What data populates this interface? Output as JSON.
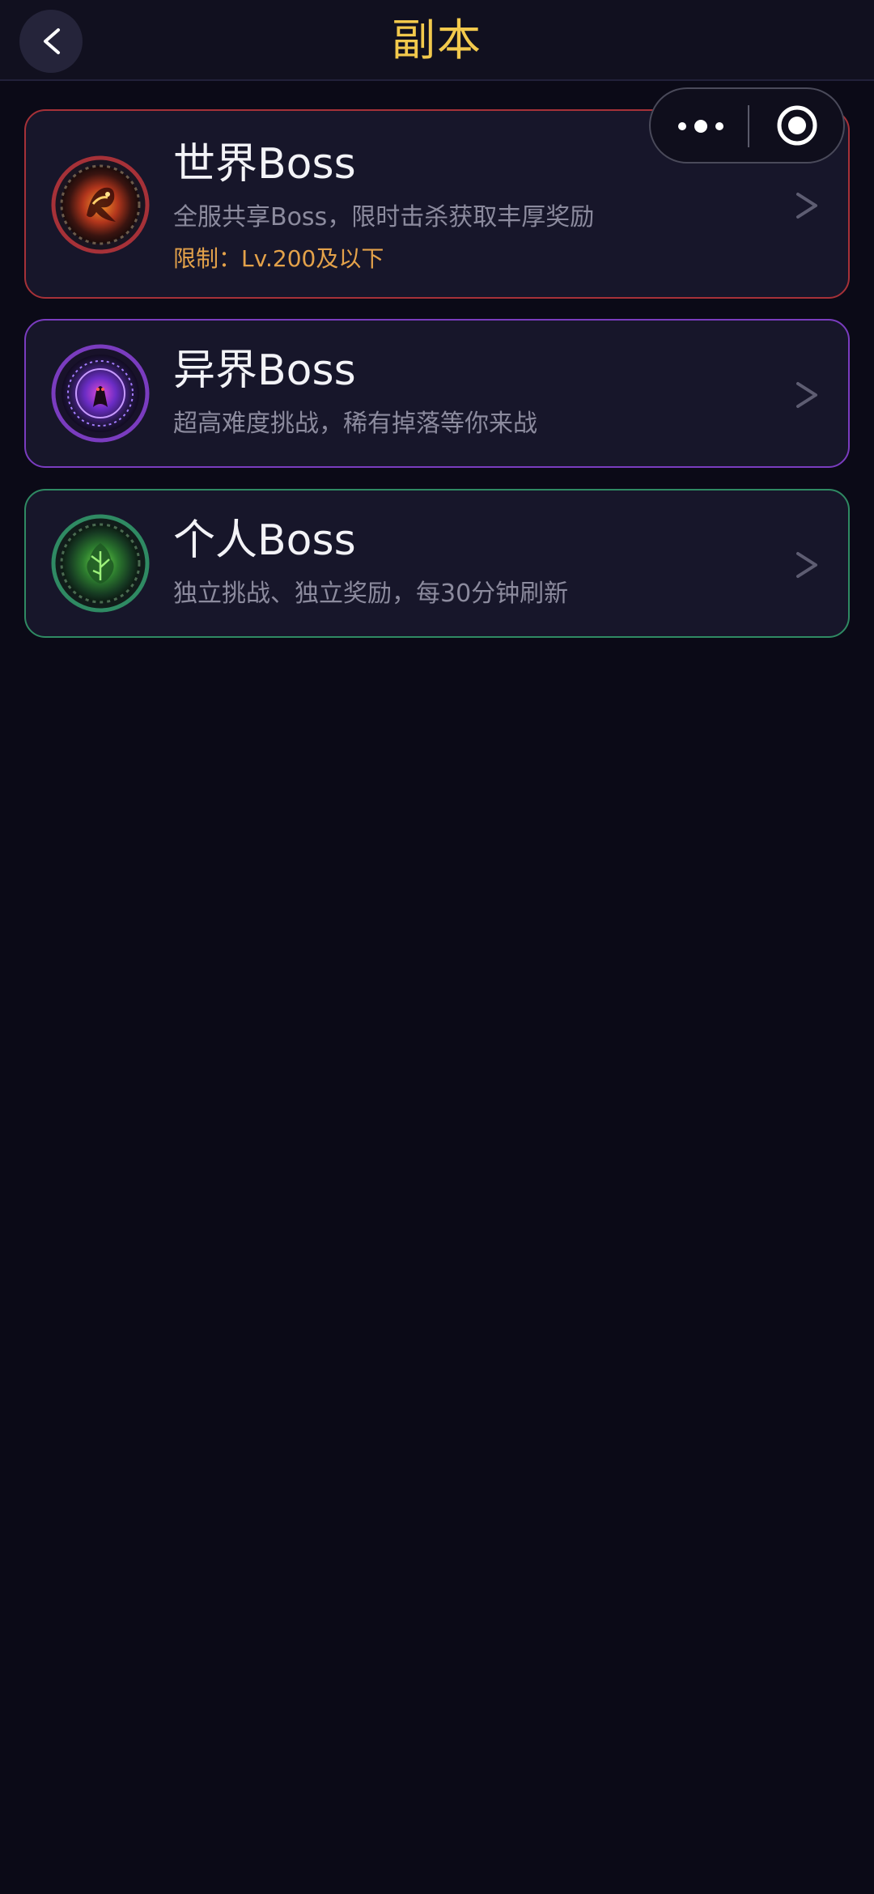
{
  "header": {
    "title": "副本",
    "back_icon": "chevron-left-icon"
  },
  "capsule": {
    "more_icon": "more-dots-icon",
    "close_icon": "target-circle-icon"
  },
  "dungeons": [
    {
      "title": "世界Boss",
      "description": "全服共享Boss，限时击杀获取丰厚奖励",
      "limit": "限制：Lv.200及以下",
      "accent": "#a63138",
      "emblem_icon": "dragon-emblem-icon",
      "arrow": ">"
    },
    {
      "title": "异界Boss",
      "description": "超高难度挑战，稀有掉落等你来战",
      "accent": "#7a3cbf",
      "emblem_icon": "demon-portal-emblem-icon",
      "arrow": ">"
    },
    {
      "title": "个人Boss",
      "description": "独立挑战、独立奖励，每30分钟刷新",
      "accent": "#2f8a63",
      "emblem_icon": "tree-creature-emblem-icon",
      "arrow": ">"
    }
  ],
  "colors": {
    "background": "#0b0a17",
    "title_gold": "#f2c94c",
    "limit_orange": "#e4a24a",
    "card_bg": "#17162a"
  }
}
